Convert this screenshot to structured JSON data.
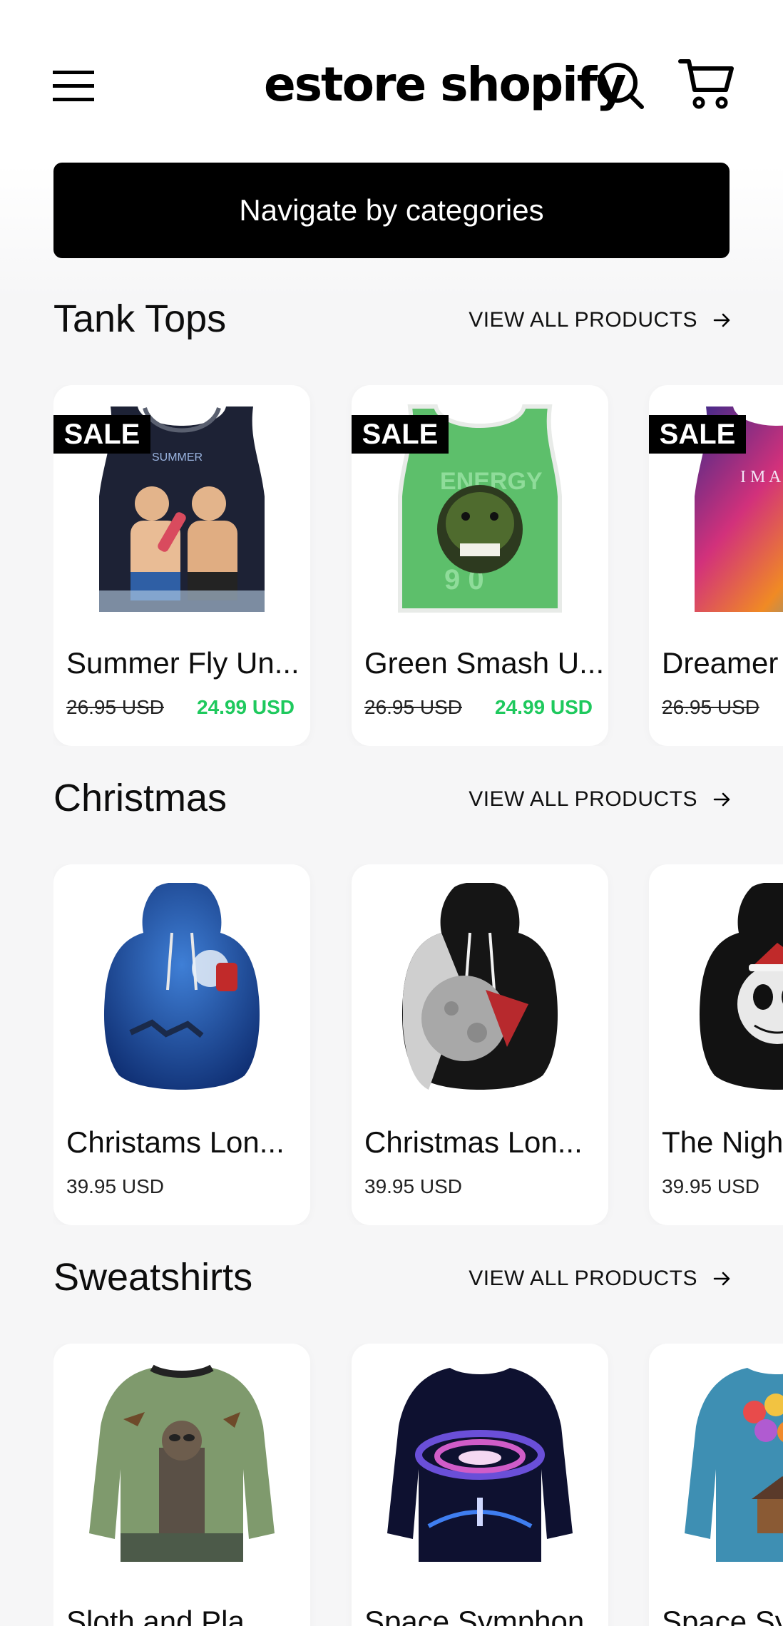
{
  "header": {
    "logo_text": "estore shopify",
    "nav_button_label": "Navigate by categories"
  },
  "colors": {
    "sale_price": "#1ec95d",
    "primary_button": "#000000",
    "card_background": "#ffffff"
  },
  "sections": [
    {
      "title": "Tank Tops",
      "view_all_label": "VIEW ALL PRODUCTS",
      "products": [
        {
          "badge": "SALE",
          "name": "Summer Fly Un...",
          "old_price": "26.95 USD",
          "price": "24.99 USD",
          "image": "tank-top-summer-fly"
        },
        {
          "badge": "SALE",
          "name": "Green Smash U...",
          "old_price": "26.95 USD",
          "price": "24.99 USD",
          "image": "tank-top-green-smash"
        },
        {
          "badge": "SALE",
          "name": "Dreamer",
          "old_price": "26.95 USD",
          "price": "",
          "image": "tank-top-dreamer"
        }
      ]
    },
    {
      "title": "Christmas",
      "view_all_label": "VIEW ALL PRODUCTS",
      "products": [
        {
          "name": "Christams Lon...",
          "price": "39.95 USD",
          "image": "hoodie-santa-sleigh"
        },
        {
          "name": "Christmas Lon...",
          "price": "39.95 USD",
          "image": "hoodie-moon-santa-hat"
        },
        {
          "name": "The Night",
          "price": "39.95 USD",
          "image": "hoodie-jack-skellington"
        }
      ]
    },
    {
      "title": "Sweatshirts",
      "view_all_label": "VIEW ALL PRODUCTS",
      "products": [
        {
          "name": "Sloth and Pla...",
          "image": "sweatshirt-sloth"
        },
        {
          "name": "Space Symphon...",
          "image": "sweatshirt-space-symphony"
        },
        {
          "name": "Space Sy...",
          "image": "sweatshirt-balloons-house"
        }
      ]
    }
  ],
  "icons": {
    "menu": "hamburger-menu-icon",
    "search": "search-icon",
    "cart": "cart-icon",
    "arrow": "arrow-right-icon"
  }
}
